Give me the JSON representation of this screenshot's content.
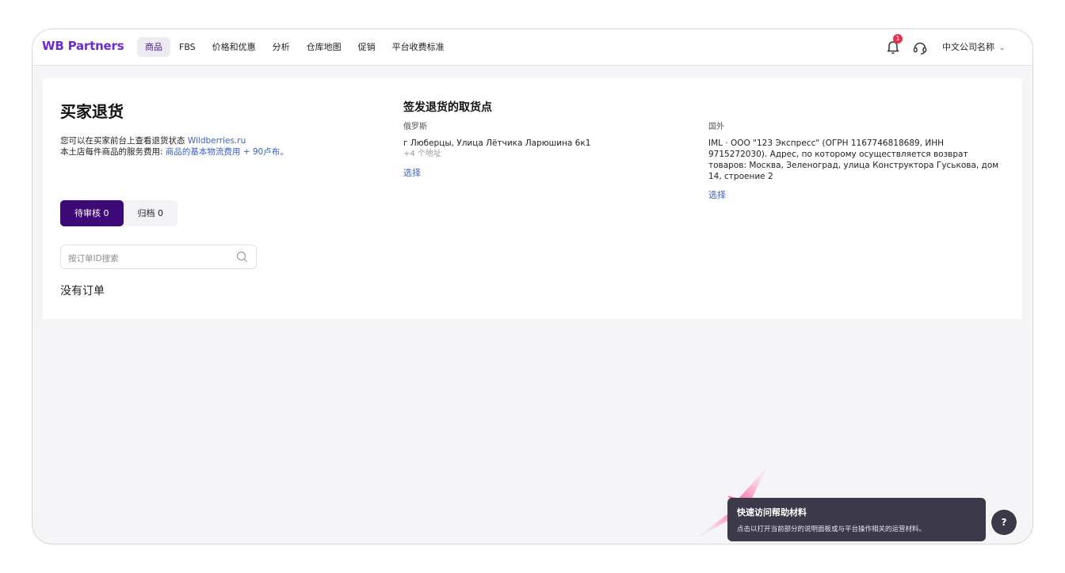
{
  "topbar": {
    "logo": "WB Partners",
    "nav": [
      "商品",
      "FBS",
      "价格和优惠",
      "分析",
      "仓库地图",
      "促销",
      "平台收费标准"
    ],
    "notification_count": "1",
    "company": "中文公司名称",
    "accent_color": "#6b2bd0"
  },
  "returns": {
    "title": "买家退货",
    "intro_text": "您可以在买家前台上查看退货状态",
    "intro_link": "Wildberries.ru",
    "fee_text": "本土店每件商品的服务费用:",
    "fee_link": "商品的基本物流费用 + 90卢布。",
    "tabs": [
      "待审核 0",
      "归档 0"
    ],
    "search_placeholder": "按订单ID搜索",
    "empty_text": "没有订单"
  },
  "pickup": {
    "title": "签发退货的取货点",
    "russia_label": "俄罗斯",
    "russia_address": "г Люберцы, Улица Лётчика Ларюшина 6к1",
    "more_addresses": "+4 个地址",
    "choose_label": "选择",
    "abroad_label": "国外",
    "abroad_address": "IML · ООО \"123 Экспресс\" (ОГРН 1167746818689, ИНН 9715272030). Адрес, по которому осуществляется возврат товаров: Москва, Зеленоград, улица Конструктора Гуськова, дом 14, строение 2",
    "abroad_choose_label": "选择"
  },
  "help": {
    "tooltip_title": "快速访问帮助材料",
    "tooltip_text": "点击以打开当前部分的说明面板或与平台操作相关的运营材料。",
    "button_label": "?"
  }
}
